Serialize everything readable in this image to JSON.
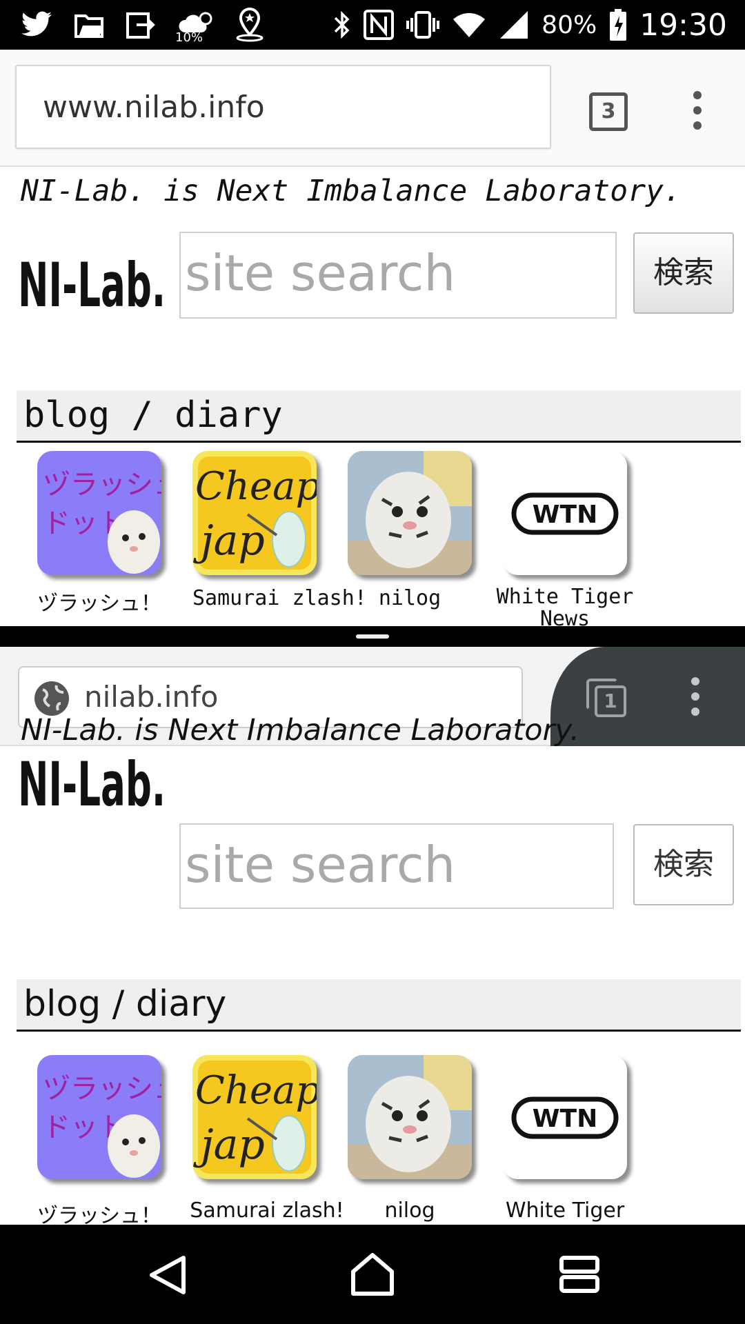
{
  "status_bar": {
    "notification_icons": [
      "twitter-icon",
      "files-icon",
      "exit-icon",
      "weather-icon",
      "location-icon"
    ],
    "weather_percent": "10%",
    "battery": "80%",
    "time": "19:30"
  },
  "top_window": {
    "url": "www.nilab.info",
    "tab_count": "3",
    "tagline": "NI-Lab. is Next Imbalance Laboratory.",
    "logo_text": "NI-Lab.",
    "search_placeholder": "site search",
    "search_button": "検索",
    "section_title": "blog / diary",
    "apps": [
      {
        "label": "ヅラッシュ！",
        "icon": "zlash-dot-icon"
      },
      {
        "label": "Samurai zlash!",
        "icon": "cheap-jap-icon"
      },
      {
        "label": "nilog",
        "icon": "white-tiger-photo-icon"
      },
      {
        "label": "White Tiger News",
        "icon": "wtn-icon",
        "badge": "WTN"
      }
    ]
  },
  "bottom_window": {
    "url": "nilab.info",
    "tab_count": "1",
    "tagline": "NI-Lab. is Next Imbalance Laboratory.",
    "logo_text": "NI-Lab.",
    "search_placeholder": "site search",
    "search_button": "検索",
    "section_title": "blog / diary",
    "apps": [
      {
        "label": "ヅラッシュ！",
        "icon": "zlash-dot-icon"
      },
      {
        "label": "Samurai zlash!",
        "icon": "cheap-jap-icon"
      },
      {
        "label": "nilog",
        "icon": "white-tiger-photo-icon"
      },
      {
        "label": "White Tiger",
        "icon": "wtn-icon",
        "badge": "WTN"
      }
    ]
  },
  "icon_text": {
    "zlash_line1": "ヅラッシュ",
    "zlash_line2": "ドット",
    "cheap_line1": "Cheap",
    "cheap_line2": "jap"
  },
  "nav_bar": {
    "buttons": [
      "back-icon",
      "home-icon",
      "recents-icon"
    ]
  },
  "colors": {
    "purple_icon_bg": "#8b7cf7",
    "cheap_icon_bg": "#f5c820",
    "dark_tabstrip": "#3b4043"
  }
}
